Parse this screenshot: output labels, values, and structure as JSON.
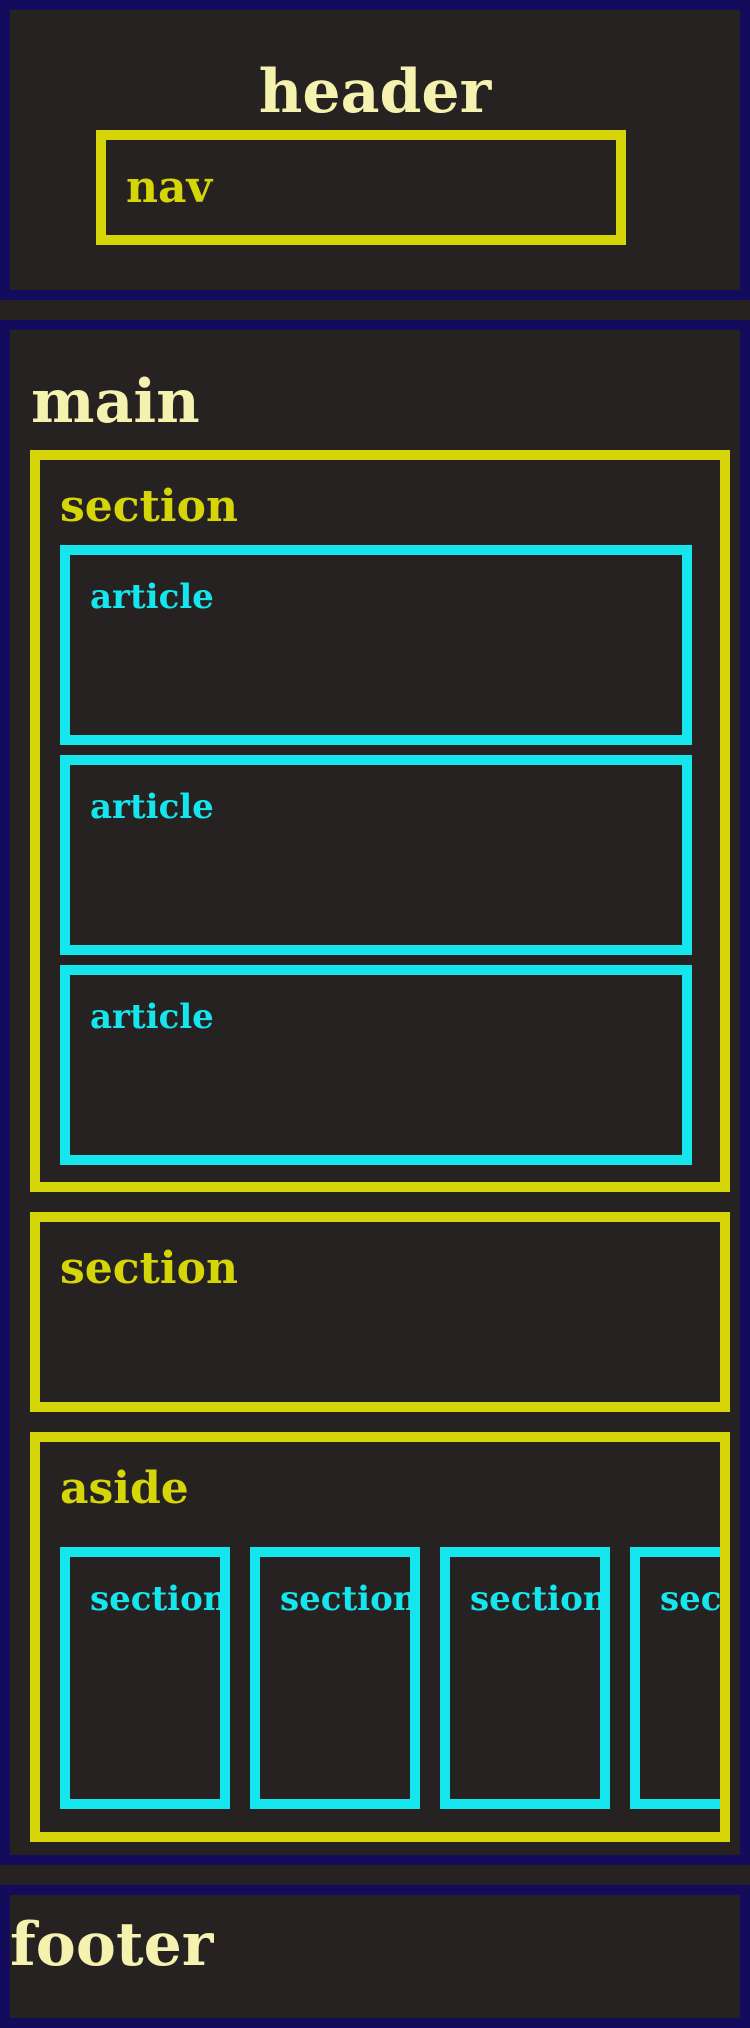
{
  "header": {
    "label": "header"
  },
  "nav": {
    "label": "nav"
  },
  "main": {
    "label": "main"
  },
  "section_1": {
    "label": "section",
    "articles": [
      "article",
      "article",
      "article"
    ]
  },
  "section_2": {
    "label": "section"
  },
  "aside": {
    "label": "aside",
    "sections": [
      "section",
      "section",
      "section",
      "section"
    ]
  },
  "footer": {
    "label": "footer"
  },
  "colors": {
    "outer_border": "#130c5c",
    "container_border": "#d5d508",
    "child_border": "#15e6ee",
    "background": "#272222",
    "title_text": "#f5f2b0"
  }
}
